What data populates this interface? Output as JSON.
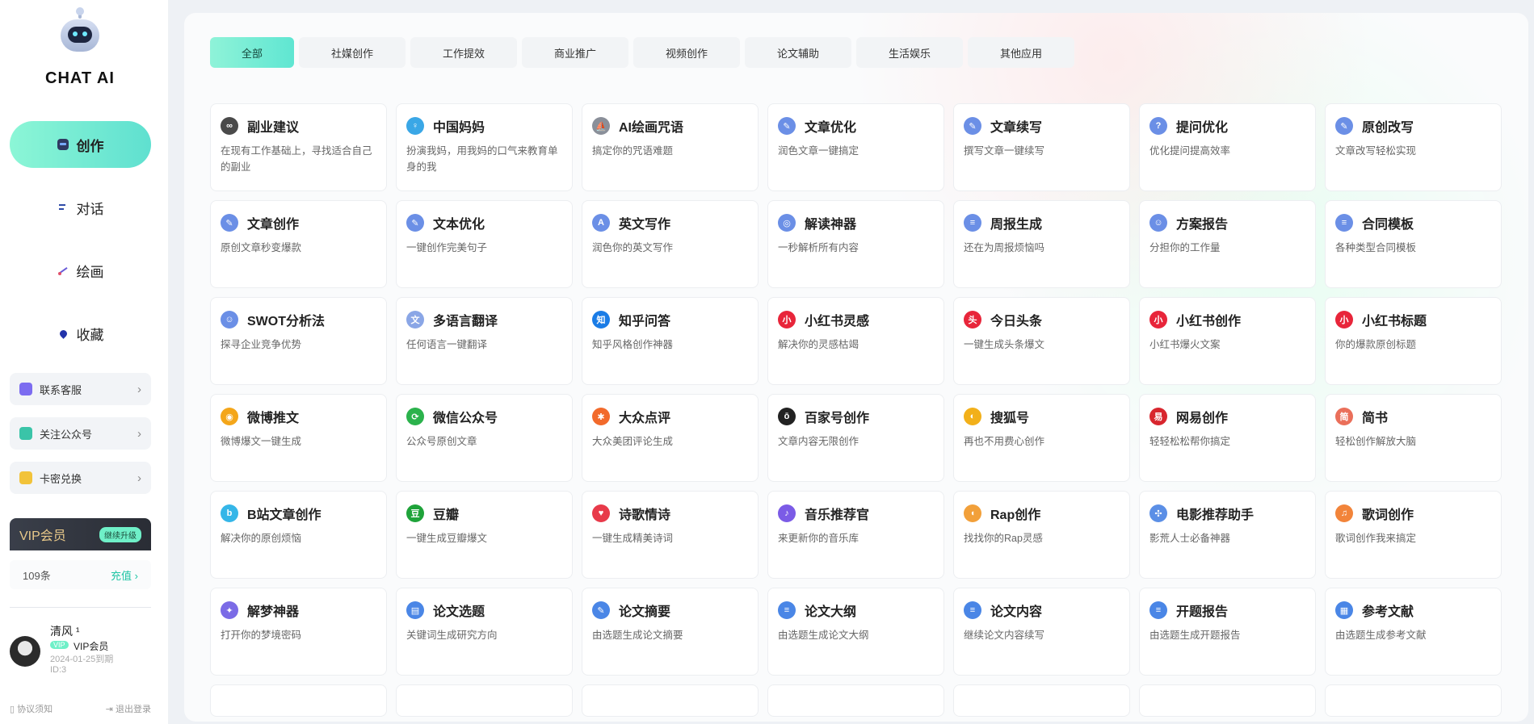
{
  "brand": "CHAT AI",
  "nav": [
    {
      "label": "创作",
      "icon": "chat-bot-icon",
      "active": true
    },
    {
      "label": "对话",
      "icon": "dialog-icon",
      "active": false
    },
    {
      "label": "绘画",
      "icon": "draw-icon",
      "active": false
    },
    {
      "label": "收藏",
      "icon": "favorite-icon",
      "active": false
    }
  ],
  "side_links": {
    "service": "联系客服",
    "follow": "关注公众号",
    "redeem": "卡密兑换"
  },
  "vip": {
    "title": "VIP会员",
    "upgrade": "继续升级",
    "count": "109条",
    "recharge": "充值"
  },
  "user": {
    "name": "清风 ¹",
    "badge": "VIP",
    "level": "VIP会员",
    "expire": "2024-01-25到期",
    "id": "ID:3"
  },
  "footer": {
    "agreement": "协议须知",
    "logout": "退出登录"
  },
  "tabs": [
    "全部",
    "社媒创作",
    "工作提效",
    "商业推广",
    "视频创作",
    "论文辅助",
    "生活娱乐",
    "其他应用"
  ],
  "cards": [
    {
      "title": "副业建议",
      "desc": "在现有工作基础上，寻找适合自己的副业",
      "icon": "glasses-icon",
      "color": "#4a4a4a",
      "glyph": "∞"
    },
    {
      "title": "中国妈妈",
      "desc": "扮演我妈，用我妈的口气来教育单身的我",
      "icon": "mother-icon",
      "color": "#3aa7e6",
      "glyph": "♀"
    },
    {
      "title": "AI绘画咒语",
      "desc": "搞定你的咒语难题",
      "icon": "sail-icon",
      "color": "#8a8f99",
      "glyph": "⛵"
    },
    {
      "title": "文章优化",
      "desc": "润色文章一键搞定",
      "icon": "article-optimize-icon",
      "color": "#6b8fe6",
      "glyph": "✎"
    },
    {
      "title": "文章续写",
      "desc": "撰写文章一键续写",
      "icon": "article-continue-icon",
      "color": "#6b8fe6",
      "glyph": "✎"
    },
    {
      "title": "提问优化",
      "desc": "优化提问提高效率",
      "icon": "question-icon",
      "color": "#6b8fe6",
      "glyph": "?"
    },
    {
      "title": "原创改写",
      "desc": "文章改写轻松实现",
      "icon": "rewrite-icon",
      "color": "#6b8fe6",
      "glyph": "✎"
    },
    {
      "title": "文章创作",
      "desc": "原创文章秒变爆款",
      "icon": "article-create-icon",
      "color": "#6b8fe6",
      "glyph": "✎"
    },
    {
      "title": "文本优化",
      "desc": "一键创作完美句子",
      "icon": "text-optimize-icon",
      "color": "#6b8fe6",
      "glyph": "✎"
    },
    {
      "title": "英文写作",
      "desc": "润色你的英文写作",
      "icon": "english-icon",
      "color": "#6b8fe6",
      "glyph": "A"
    },
    {
      "title": "解读神器",
      "desc": "一秒解析所有内容",
      "icon": "interpret-icon",
      "color": "#6b8fe6",
      "glyph": "◎"
    },
    {
      "title": "周报生成",
      "desc": "还在为周报烦恼吗",
      "icon": "weekly-report-icon",
      "color": "#6b8fe6",
      "glyph": "≡"
    },
    {
      "title": "方案报告",
      "desc": "分担你的工作量",
      "icon": "plan-report-icon",
      "color": "#6b8fe6",
      "glyph": "☺"
    },
    {
      "title": "合同模板",
      "desc": "各种类型合同模板",
      "icon": "contract-icon",
      "color": "#6b8fe6",
      "glyph": "≡"
    },
    {
      "title": "SWOT分析法",
      "desc": "探寻企业竞争优势",
      "icon": "swot-icon",
      "color": "#6b8fe6",
      "glyph": "☺"
    },
    {
      "title": "多语言翻译",
      "desc": "任何语言一键翻译",
      "icon": "translate-icon",
      "color": "#8aa6e6",
      "glyph": "文"
    },
    {
      "title": "知乎问答",
      "desc": "知乎风格创作神器",
      "icon": "zhihu-icon",
      "color": "#1a7ce6",
      "glyph": "知"
    },
    {
      "title": "小红书灵感",
      "desc": "解决你的灵感枯竭",
      "icon": "xiaohongshu-icon",
      "color": "#e8253a",
      "glyph": "小"
    },
    {
      "title": "今日头条",
      "desc": "一键生成头条爆文",
      "icon": "toutiao-icon",
      "color": "#e8253a",
      "glyph": "头"
    },
    {
      "title": "小红书创作",
      "desc": "小红书爆火文案",
      "icon": "xiaohongshu-icon",
      "color": "#e8253a",
      "glyph": "小"
    },
    {
      "title": "小红书标题",
      "desc": "你的爆款原创标题",
      "icon": "xiaohongshu-icon",
      "color": "#e8253a",
      "glyph": "小"
    },
    {
      "title": "微博推文",
      "desc": "微博爆文一键生成",
      "icon": "weibo-icon",
      "color": "#f4a61a",
      "glyph": "◉"
    },
    {
      "title": "微信公众号",
      "desc": "公众号原创文章",
      "icon": "wechat-icon",
      "color": "#2bb24c",
      "glyph": "⟳"
    },
    {
      "title": "大众点评",
      "desc": "大众美团评论生成",
      "icon": "dianping-icon",
      "color": "#f26a2b",
      "glyph": "✱"
    },
    {
      "title": "百家号创作",
      "desc": "文章内容无限创作",
      "icon": "baijiahao-icon",
      "color": "#222222",
      "glyph": "ō"
    },
    {
      "title": "搜狐号",
      "desc": "再也不用费心创作",
      "icon": "sohu-icon",
      "color": "#f2b01a",
      "glyph": "◐"
    },
    {
      "title": "网易创作",
      "desc": "轻轻松松帮你搞定",
      "icon": "netease-icon",
      "color": "#d8262e",
      "glyph": "易"
    },
    {
      "title": "简书",
      "desc": "轻松创作解放大脑",
      "icon": "jianshu-icon",
      "color": "#ea6f5a",
      "glyph": "简"
    },
    {
      "title": "B站文章创作",
      "desc": "解决你的原创烦恼",
      "icon": "bilibili-icon",
      "color": "#35b6e8",
      "glyph": "b"
    },
    {
      "title": "豆瓣",
      "desc": "一键生成豆瓣爆文",
      "icon": "douban-icon",
      "color": "#1fa33a",
      "glyph": "豆"
    },
    {
      "title": "诗歌情诗",
      "desc": "一键生成精美诗词",
      "icon": "heart-icon",
      "color": "#e83a4a",
      "glyph": "♥"
    },
    {
      "title": "音乐推荐官",
      "desc": "来更新你的音乐库",
      "icon": "music-icon",
      "color": "#7b5be6",
      "glyph": "♪"
    },
    {
      "title": "Rap创作",
      "desc": "找找你的Rap灵感",
      "icon": "rap-icon",
      "color": "#f2a03a",
      "glyph": "◖"
    },
    {
      "title": "电影推荐助手",
      "desc": "影荒人士必备神器",
      "icon": "film-icon",
      "color": "#5b8fe6",
      "glyph": "✣"
    },
    {
      "title": "歌词创作",
      "desc": "歌词创作我来搞定",
      "icon": "lyrics-icon",
      "color": "#f2843a",
      "glyph": "♫"
    },
    {
      "title": "解梦神器",
      "desc": "打开你的梦境密码",
      "icon": "dream-icon",
      "color": "#7b6be6",
      "glyph": "✦"
    },
    {
      "title": "论文选题",
      "desc": "关键词生成研究方向",
      "icon": "paper-topic-icon",
      "color": "#4a86e6",
      "glyph": "▤"
    },
    {
      "title": "论文摘要",
      "desc": "由选题生成论文摘要",
      "icon": "paper-abstract-icon",
      "color": "#4a86e6",
      "glyph": "✎"
    },
    {
      "title": "论文大纲",
      "desc": "由选题生成论文大纲",
      "icon": "paper-outline-icon",
      "color": "#4a86e6",
      "glyph": "≡"
    },
    {
      "title": "论文内容",
      "desc": "继续论文内容续写",
      "icon": "paper-content-icon",
      "color": "#4a86e6",
      "glyph": "≡"
    },
    {
      "title": "开题报告",
      "desc": "由选题生成开题报告",
      "icon": "proposal-icon",
      "color": "#4a86e6",
      "glyph": "≡"
    },
    {
      "title": "参考文献",
      "desc": "由选题生成参考文献",
      "icon": "reference-icon",
      "color": "#4a86e6",
      "glyph": "▦"
    }
  ]
}
